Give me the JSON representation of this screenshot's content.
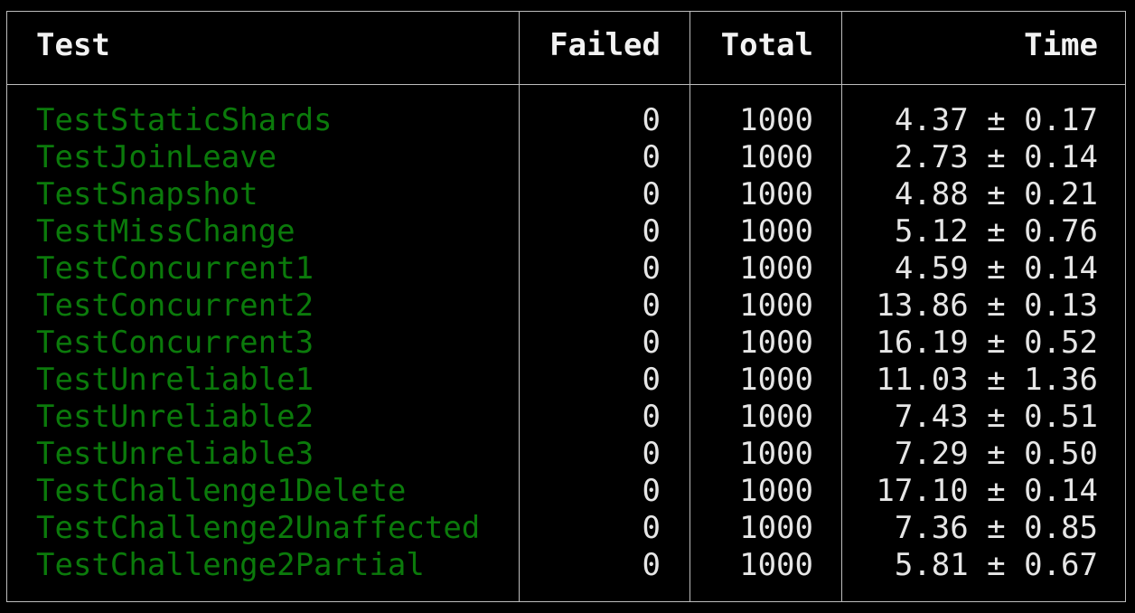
{
  "table": {
    "headers": {
      "test": "Test",
      "failed": "Failed",
      "total": "Total",
      "time": "Time"
    },
    "rows": [
      {
        "test": "TestStaticShards",
        "failed": "0",
        "total": "1000",
        "time": "4.37 ± 0.17"
      },
      {
        "test": "TestJoinLeave",
        "failed": "0",
        "total": "1000",
        "time": "2.73 ± 0.14"
      },
      {
        "test": "TestSnapshot",
        "failed": "0",
        "total": "1000",
        "time": "4.88 ± 0.21"
      },
      {
        "test": "TestMissChange",
        "failed": "0",
        "total": "1000",
        "time": "5.12 ± 0.76"
      },
      {
        "test": "TestConcurrent1",
        "failed": "0",
        "total": "1000",
        "time": "4.59 ± 0.14"
      },
      {
        "test": "TestConcurrent2",
        "failed": "0",
        "total": "1000",
        "time": "13.86 ± 0.13"
      },
      {
        "test": "TestConcurrent3",
        "failed": "0",
        "total": "1000",
        "time": "16.19 ± 0.52"
      },
      {
        "test": "TestUnreliable1",
        "failed": "0",
        "total": "1000",
        "time": "11.03 ± 1.36"
      },
      {
        "test": "TestUnreliable2",
        "failed": "0",
        "total": "1000",
        "time": "7.43 ± 0.51"
      },
      {
        "test": "TestUnreliable3",
        "failed": "0",
        "total": "1000",
        "time": "7.29 ± 0.50"
      },
      {
        "test": "TestChallenge1Delete",
        "failed": "0",
        "total": "1000",
        "time": "17.10 ± 0.14"
      },
      {
        "test": "TestChallenge2Unaffected",
        "failed": "0",
        "total": "1000",
        "time": "7.36 ± 0.85"
      },
      {
        "test": "TestChallenge2Partial",
        "failed": "0",
        "total": "1000",
        "time": "5.81 ± 0.67"
      }
    ]
  },
  "colors": {
    "background": "#000000",
    "pass_name": "#0b7a0b",
    "text": "#e6e6e6",
    "border": "#bdbdbd"
  }
}
